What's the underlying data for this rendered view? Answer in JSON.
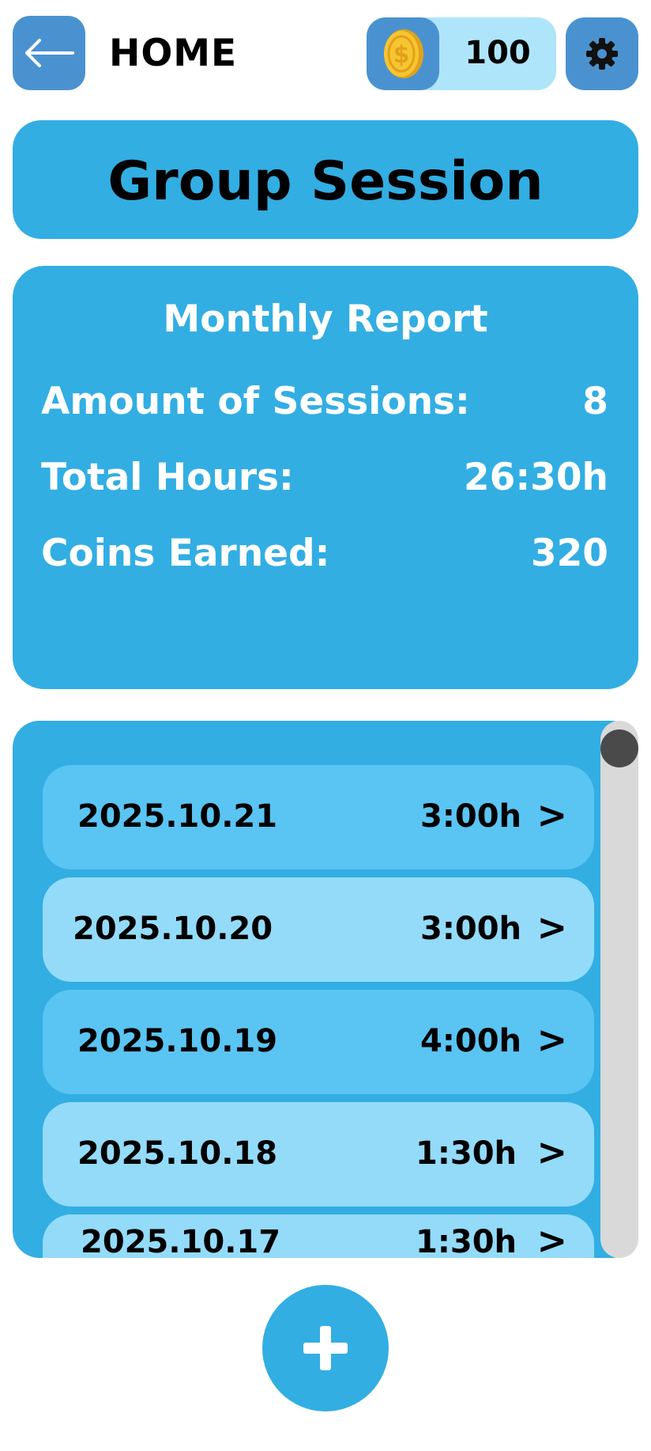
{
  "header": {
    "back_icon": "arrow-left-icon",
    "home_label": "HOME",
    "coin_icon": "coin-icon",
    "coins": "100",
    "settings_icon": "gear-icon"
  },
  "page_title": "Group Session",
  "report": {
    "title": "Monthly Report",
    "rows": [
      {
        "label": "Amount of Sessions:",
        "value": "8"
      },
      {
        "label": "Total Hours:",
        "value": "26:30h"
      },
      {
        "label": "Coins Earned:",
        "value": "320"
      }
    ]
  },
  "sessions": [
    {
      "date": "2025.10.21",
      "hours": "3:00h",
      "arrow": ">"
    },
    {
      "date": "2025.10.20",
      "hours": "3:00h",
      "arrow": ">"
    },
    {
      "date": "2025.10.19",
      "hours": "4:00h",
      "arrow": ">"
    },
    {
      "date": "2025.10.18",
      "hours": "1:30h",
      "arrow": ">"
    },
    {
      "date": "2025.10.17",
      "hours": "1:30h",
      "arrow": ">"
    }
  ],
  "fab_icon": "plus-icon",
  "colors": {
    "accent": "#32aee3",
    "button": "#4a92cf",
    "row_dark": "#5ac4f3",
    "row_light": "#93dbf9",
    "coin_pill": "#aee5fb"
  }
}
